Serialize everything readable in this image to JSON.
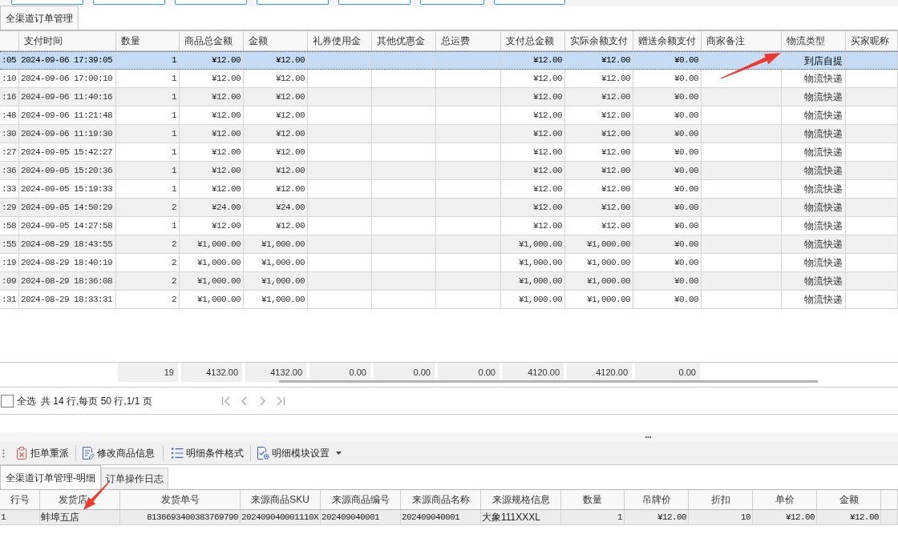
{
  "top_toolbar": {
    "buttons": [
      {
        "kind": "clipped"
      },
      {
        "kind": "clipped"
      },
      {
        "kind": "clipped"
      },
      {
        "kind": "clipped"
      },
      {
        "kind": "clipped"
      },
      {
        "kind": "clipped"
      },
      {
        "kind": "clipped"
      }
    ]
  },
  "tabs": [
    {
      "label": "全渠道订单管理",
      "selected": true
    }
  ],
  "orders_table": {
    "headers": {
      "pay_time": "支付时间",
      "quantity": "数量",
      "goods_total": "商品总金额",
      "amount": "金额",
      "coupon_amount": "礼券使用金",
      "other_discount": "其他优惠金",
      "shipping_fee": "总运费",
      "pay_total": "支付总金额",
      "balance_paid": "实际余额支付",
      "gift_balance_paid": "赠送余额支付",
      "merchant_note": "商家备注",
      "logistics_type": "物流类型",
      "buyer_nickname": "买家昵称"
    },
    "rows": [
      {
        "selected": true,
        "column_1": ":05",
        "pay_time": "2024-09-06 17:39:05",
        "quantity": "1",
        "goods_total": "¥12.00",
        "amount": "¥12.00",
        "pay_total": "¥12.00",
        "balance_paid": "¥12.00",
        "gift_balance_paid": "¥0.00",
        "logistics_type": "到店自提"
      },
      {
        "selected": false,
        "column_1": ":10",
        "pay_time": "2024-09-06 17:00:10",
        "quantity": "1",
        "goods_total": "¥12.00",
        "amount": "¥12.00",
        "pay_total": "¥12.00",
        "balance_paid": "¥12.00",
        "gift_balance_paid": "¥0.00",
        "logistics_type": "物流快递"
      },
      {
        "selected": false,
        "column_1": ":16",
        "pay_time": "2024-09-06 11:40:16",
        "quantity": "1",
        "goods_total": "¥12.00",
        "amount": "¥12.00",
        "pay_total": "¥12.00",
        "balance_paid": "¥12.00",
        "gift_balance_paid": "¥0.00",
        "logistics_type": "物流快递"
      },
      {
        "selected": false,
        "column_1": ":48",
        "pay_time": "2024-09-06 11:21:48",
        "quantity": "1",
        "goods_total": "¥12.00",
        "amount": "¥12.00",
        "pay_total": "¥12.00",
        "balance_paid": "¥12.00",
        "gift_balance_paid": "¥0.00",
        "logistics_type": "物流快递"
      },
      {
        "selected": false,
        "column_1": ":30",
        "pay_time": "2024-09-06 11:19:30",
        "quantity": "1",
        "goods_total": "¥12.00",
        "amount": "¥12.00",
        "pay_total": "¥12.00",
        "balance_paid": "¥12.00",
        "gift_balance_paid": "¥0.00",
        "logistics_type": "物流快递"
      },
      {
        "selected": false,
        "column_1": ":27",
        "pay_time": "2024-09-05 15:42:27",
        "quantity": "1",
        "goods_total": "¥12.00",
        "amount": "¥12.00",
        "pay_total": "¥12.00",
        "balance_paid": "¥12.00",
        "gift_balance_paid": "¥0.00",
        "logistics_type": "物流快递"
      },
      {
        "selected": false,
        "column_1": ":36",
        "pay_time": "2024-09-05 15:20:36",
        "quantity": "1",
        "goods_total": "¥12.00",
        "amount": "¥12.00",
        "pay_total": "¥12.00",
        "balance_paid": "¥12.00",
        "gift_balance_paid": "¥0.00",
        "logistics_type": "物流快递"
      },
      {
        "selected": false,
        "column_1": ":33",
        "pay_time": "2024-09-05 15:19:33",
        "quantity": "1",
        "goods_total": "¥12.00",
        "amount": "¥12.00",
        "pay_total": "¥12.00",
        "balance_paid": "¥12.00",
        "gift_balance_paid": "¥0.00",
        "logistics_type": "物流快递"
      },
      {
        "selected": false,
        "column_1": ":29",
        "pay_time": "2024-09-05 14:50:29",
        "quantity": "2",
        "goods_total": "¥24.00",
        "amount": "¥24.00",
        "pay_total": "¥12.00",
        "balance_paid": "¥12.00",
        "gift_balance_paid": "¥0.00",
        "logistics_type": "物流快递"
      },
      {
        "selected": false,
        "column_1": ":58",
        "pay_time": "2024-09-05 14:27:58",
        "quantity": "1",
        "goods_total": "¥12.00",
        "amount": "¥12.00",
        "pay_total": "¥12.00",
        "balance_paid": "¥12.00",
        "gift_balance_paid": "¥0.00",
        "logistics_type": "物流快递"
      },
      {
        "selected": false,
        "column_1": ":55",
        "pay_time": "2024-08-29 18:43:55",
        "quantity": "2",
        "goods_total": "¥1,000.00",
        "amount": "¥1,000.00",
        "pay_total": "¥1,000.00",
        "balance_paid": "¥1,000.00",
        "gift_balance_paid": "¥0.00",
        "logistics_type": "物流快递"
      },
      {
        "selected": false,
        "column_1": ":19",
        "pay_time": "2024-08-29 18:40:19",
        "quantity": "2",
        "goods_total": "¥1,000.00",
        "amount": "¥1,000.00",
        "pay_total": "¥1,000.00",
        "balance_paid": "¥1,000.00",
        "gift_balance_paid": "¥0.00",
        "logistics_type": "物流快递"
      },
      {
        "selected": false,
        "column_1": ":09",
        "pay_time": "2024-08-29 18:36:08",
        "quantity": "2",
        "goods_total": "¥1,000.00",
        "amount": "¥1,000.00",
        "pay_total": "¥1,000.00",
        "balance_paid": "¥1,000.00",
        "gift_balance_paid": "¥0.00",
        "logistics_type": "物流快递"
      },
      {
        "selected": false,
        "column_1": ":31",
        "pay_time": "2024-08-29 18:33:31",
        "quantity": "2",
        "goods_total": "¥1,000.00",
        "amount": "¥1,000.00",
        "pay_total": "¥1,000.00",
        "balance_paid": "¥1,000.00",
        "gift_balance_paid": "¥0.00",
        "logistics_type": "物流快递"
      }
    ],
    "totals": {
      "quantity": "19",
      "goods_total": "4132.00",
      "amount": "4132.00",
      "coupon_amount": "0.00",
      "other_discount": "0.00",
      "shipping_fee": "0.00",
      "pay_total": "4120.00",
      "balance_paid": "4120.00",
      "gift_balance_paid": "0.00"
    }
  },
  "pager": {
    "select_all": {
      "label": "全选",
      "checked": false
    },
    "summary": "共 14 行,每页 50 行,1/1 页",
    "buttons": [
      {
        "kind": "first",
        "disabled": true
      },
      {
        "kind": "previous",
        "disabled": true
      },
      {
        "kind": "next",
        "disabled": true
      },
      {
        "kind": "last",
        "disabled": true
      }
    ]
  },
  "detail_toolbar": {
    "buttons": [
      {
        "kind": "reject",
        "label": "拒单重派",
        "dropdown": false
      },
      {
        "kind": "edit",
        "label": "修改商品信息",
        "dropdown": false
      },
      {
        "kind": "format",
        "label": "明细条件格式",
        "dropdown": false
      },
      {
        "kind": "settings",
        "label": "明细模块设置",
        "dropdown": true
      }
    ]
  },
  "detail_tabs": [
    {
      "label": "全渠道订单管理-明细",
      "selected": true
    },
    {
      "label": "订单操作日志",
      "selected": false
    }
  ],
  "detail_table": {
    "headers": {
      "row_no": "行号",
      "store": "发货店",
      "ship_no": "发货单号",
      "sku": "来源商品SKU",
      "item_code": "来源商品编号",
      "item_name": "来源商品名称",
      "spec": "来源规格信息",
      "quantity": "数量",
      "tag_price": "吊牌价",
      "discount": "折扣",
      "unit_price": "单价",
      "amount": "金额"
    },
    "rows": [
      {
        "row_no": "1",
        "store": "蚌埠五店",
        "ship_no": "8136693400383769790",
        "sku": "202409040001110X",
        "item_code": "202409040001",
        "item_name": "202409040001",
        "spec": "大象111XXXL",
        "quantity": "1",
        "tag_price": "¥12.00",
        "discount": "10",
        "unit_price": "¥12.00",
        "amount": "¥12.00"
      }
    ]
  }
}
